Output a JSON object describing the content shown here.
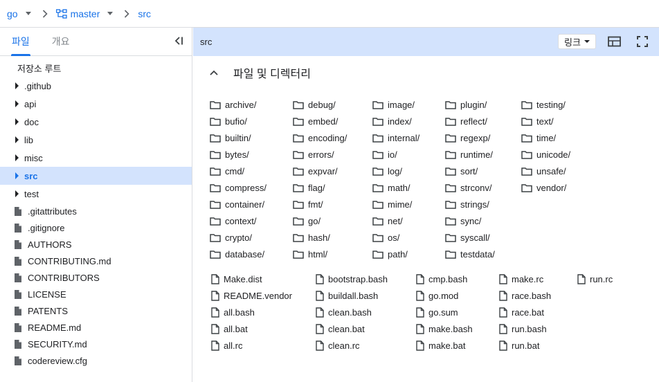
{
  "breadcrumb": {
    "repo": "go",
    "branch": "master",
    "path": "src"
  },
  "sidebar": {
    "tabs": [
      {
        "label": "파일"
      },
      {
        "label": "개요"
      }
    ],
    "root_label": "저장소 루트",
    "folders": [
      {
        "label": ".github"
      },
      {
        "label": "api"
      },
      {
        "label": "doc"
      },
      {
        "label": "lib"
      },
      {
        "label": "misc"
      },
      {
        "label": "src"
      },
      {
        "label": "test"
      }
    ],
    "selected": "src",
    "files": [
      {
        "label": ".gitattributes"
      },
      {
        "label": ".gitignore"
      },
      {
        "label": "AUTHORS"
      },
      {
        "label": "CONTRIBUTING.md"
      },
      {
        "label": "CONTRIBUTORS"
      },
      {
        "label": "LICENSE"
      },
      {
        "label": "PATENTS"
      },
      {
        "label": "README.md"
      },
      {
        "label": "SECURITY.md"
      },
      {
        "label": "codereview.cfg"
      }
    ]
  },
  "pathbar": {
    "title": "src",
    "link_label": "링크"
  },
  "section": {
    "title": "파일 및 디렉터리"
  },
  "directories": [
    [
      "archive/",
      "bufio/",
      "builtin/",
      "bytes/",
      "cmd/",
      "compress/",
      "container/",
      "context/",
      "crypto/",
      "database/"
    ],
    [
      "debug/",
      "embed/",
      "encoding/",
      "errors/",
      "expvar/",
      "flag/",
      "fmt/",
      "go/",
      "hash/",
      "html/"
    ],
    [
      "image/",
      "index/",
      "internal/",
      "io/",
      "log/",
      "math/",
      "mime/",
      "net/",
      "os/",
      "path/"
    ],
    [
      "plugin/",
      "reflect/",
      "regexp/",
      "runtime/",
      "sort/",
      "strconv/",
      "strings/",
      "sync/",
      "syscall/",
      "testdata/"
    ],
    [
      "testing/",
      "text/",
      "time/",
      "unicode/",
      "unsafe/",
      "vendor/"
    ]
  ],
  "files": [
    [
      "Make.dist",
      "README.vendor",
      "all.bash",
      "all.bat",
      "all.rc"
    ],
    [
      "bootstrap.bash",
      "buildall.bash",
      "clean.bash",
      "clean.bat",
      "clean.rc"
    ],
    [
      "cmp.bash",
      "go.mod",
      "go.sum",
      "make.bash",
      "make.bat"
    ],
    [
      "make.rc",
      "race.bash",
      "race.bat",
      "run.bash",
      "run.bat"
    ],
    [
      "run.rc"
    ]
  ],
  "colors": {
    "accent": "#1a73e8",
    "selected_bg": "#d3e3fd",
    "border": "#dadce0"
  }
}
